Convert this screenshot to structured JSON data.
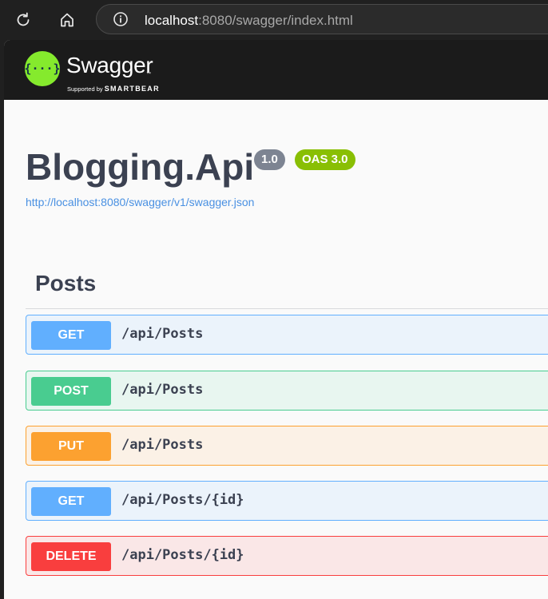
{
  "browser": {
    "url_host": "localhost",
    "url_rest": ":8080/swagger/index.html",
    "icons": [
      "reload-icon",
      "home-icon",
      "info-icon"
    ]
  },
  "topbar": {
    "logo_glyph": "{···}",
    "brand": "Swagger",
    "tm": "™",
    "supported_by": "Supported by ",
    "company": "SMARTBEAR",
    "brand_color": "#85ea2d"
  },
  "info": {
    "title": "Blogging.Api",
    "version": "1.0",
    "oas": "OAS 3.0",
    "spec_url": "http://localhost:8080/swagger/v1/swagger.json"
  },
  "tag": {
    "name": "Posts"
  },
  "operations": [
    {
      "method": "GET",
      "path": "/api/Posts",
      "color": "#61affe"
    },
    {
      "method": "POST",
      "path": "/api/Posts",
      "color": "#49cc90"
    },
    {
      "method": "PUT",
      "path": "/api/Posts",
      "color": "#fca130"
    },
    {
      "method": "GET",
      "path": "/api/Posts/{id}",
      "color": "#61affe"
    },
    {
      "method": "DELETE",
      "path": "/api/Posts/{id}",
      "color": "#f93e3e"
    }
  ]
}
